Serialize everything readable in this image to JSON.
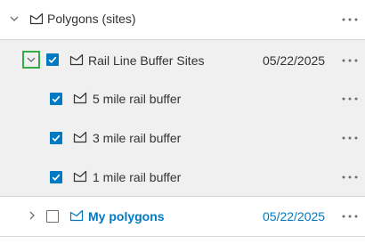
{
  "tree": {
    "parent": {
      "label": "Polygons (sites)"
    },
    "group": {
      "label": "Rail Line Buffer Sites",
      "date": "05/22/2025",
      "checked": true
    },
    "children": [
      {
        "label": "5 mile rail buffer",
        "checked": true
      },
      {
        "label": "3 mile rail buffer",
        "checked": true
      },
      {
        "label": "1 mile rail buffer",
        "checked": true
      }
    ],
    "sibling": {
      "label": "My polygons",
      "date": "05/22/2025",
      "checked": false
    }
  },
  "colors": {
    "accent": "#0079c1",
    "focus": "#35ac46",
    "row_selected_bg": "#f0f0f0"
  },
  "icons": {
    "expand": "chevron-down-icon",
    "collapse": "chevron-right-icon",
    "layer": "layer-envelope-icon",
    "more": "more-options-icon"
  }
}
